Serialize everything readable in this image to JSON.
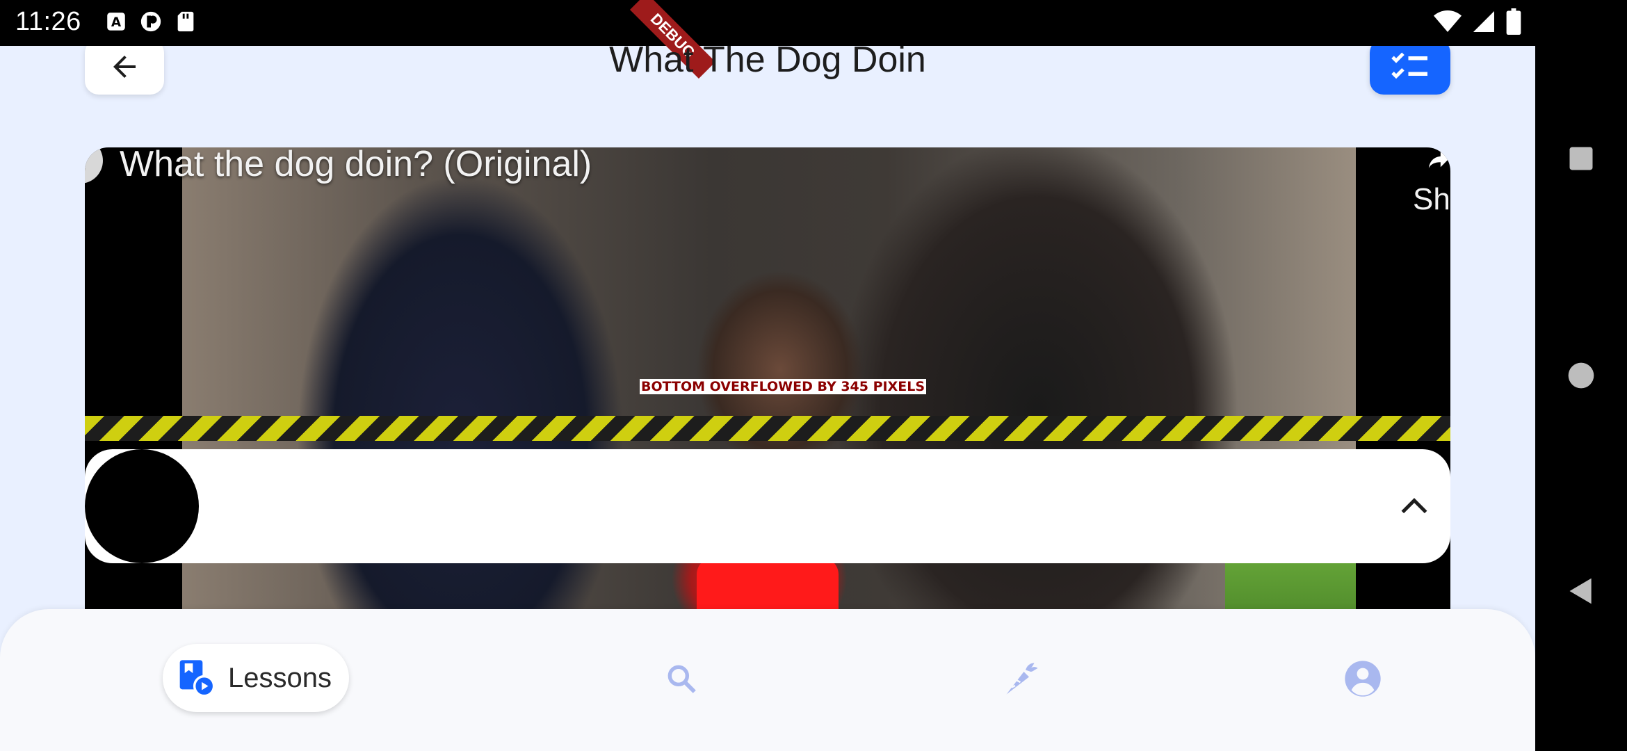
{
  "status_bar": {
    "time": "11:26",
    "left_icons": [
      "a-icon",
      "circle-app-icon",
      "sd-card-icon"
    ],
    "right_icons": [
      "wifi-icon",
      "signal-icon",
      "battery-icon"
    ],
    "debug_ribbon": "DEBUG"
  },
  "header": {
    "title": "What The Dog Doin",
    "back_icon": "arrow-left-icon",
    "checklist_icon": "checklist-icon"
  },
  "video": {
    "title": "What the dog doin? (Original)",
    "share_label": "Sh"
  },
  "overflow_warning": "BOTTOM OVERFLOWED BY 345 PIXELS",
  "player_bar": {
    "expand_icon": "chevron-up-icon"
  },
  "bottom_nav": {
    "items": [
      {
        "label": "Lessons",
        "icon": "lessons-icon",
        "selected": true
      },
      {
        "label": "",
        "icon": "search-icon",
        "selected": false
      },
      {
        "label": "",
        "icon": "carrot-icon",
        "selected": false
      },
      {
        "label": "",
        "icon": "account-icon",
        "selected": false
      }
    ]
  },
  "system_nav": {
    "buttons": [
      "recents-icon",
      "home-icon",
      "back-icon"
    ]
  },
  "colors": {
    "accent": "#1565ff",
    "background": "#e9f0ff",
    "nav_inactive": "#a9b8ef"
  }
}
